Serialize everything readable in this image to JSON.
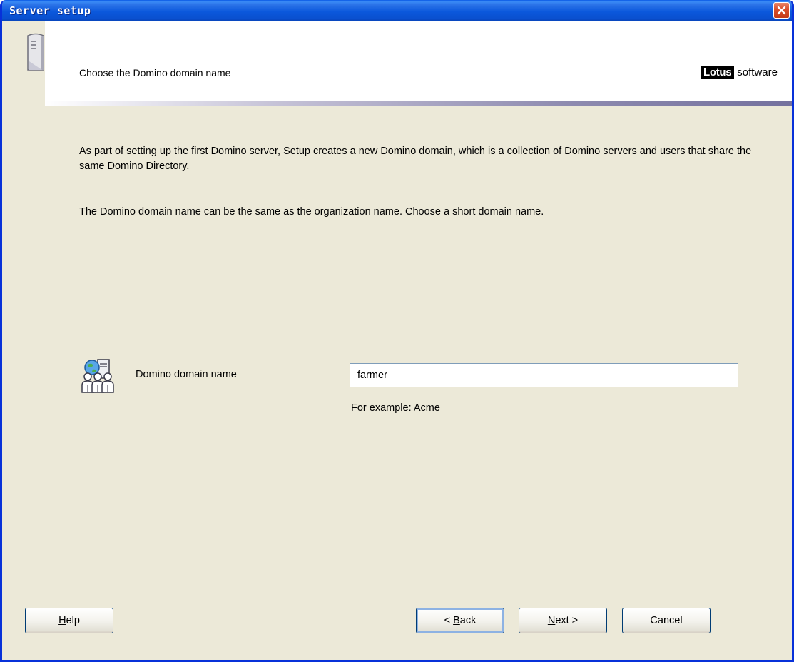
{
  "window": {
    "title": "Server setup",
    "close_label": "×"
  },
  "header": {
    "title": "Choose the Domino domain name",
    "brand_lotus": "Lotus",
    "brand_software": "software"
  },
  "main": {
    "description_1": "As part of setting up the first Domino server, Setup creates a new Domino domain, which is a collection of Domino servers and users that share the same Domino Directory.",
    "description_2": "The Domino domain name can be the same as the organization name. Choose a short domain name.",
    "domain_field": {
      "label": "Domino domain name",
      "value": "farmer",
      "hint": "For example: Acme"
    }
  },
  "buttons": {
    "help": {
      "mnemonic": "H",
      "rest": "elp"
    },
    "back": {
      "prefix": "< ",
      "mnemonic": "B",
      "rest": "ack"
    },
    "next": {
      "mnemonic": "N",
      "rest": "ext >"
    },
    "cancel": "Cancel"
  },
  "icons": {
    "server": "server-icon",
    "domain": "domain-users-icon",
    "close": "close-icon"
  },
  "colors": {
    "titlebar": "#0a50d0",
    "window_bg": "#ece9d8",
    "close_button": "#d9502d"
  }
}
